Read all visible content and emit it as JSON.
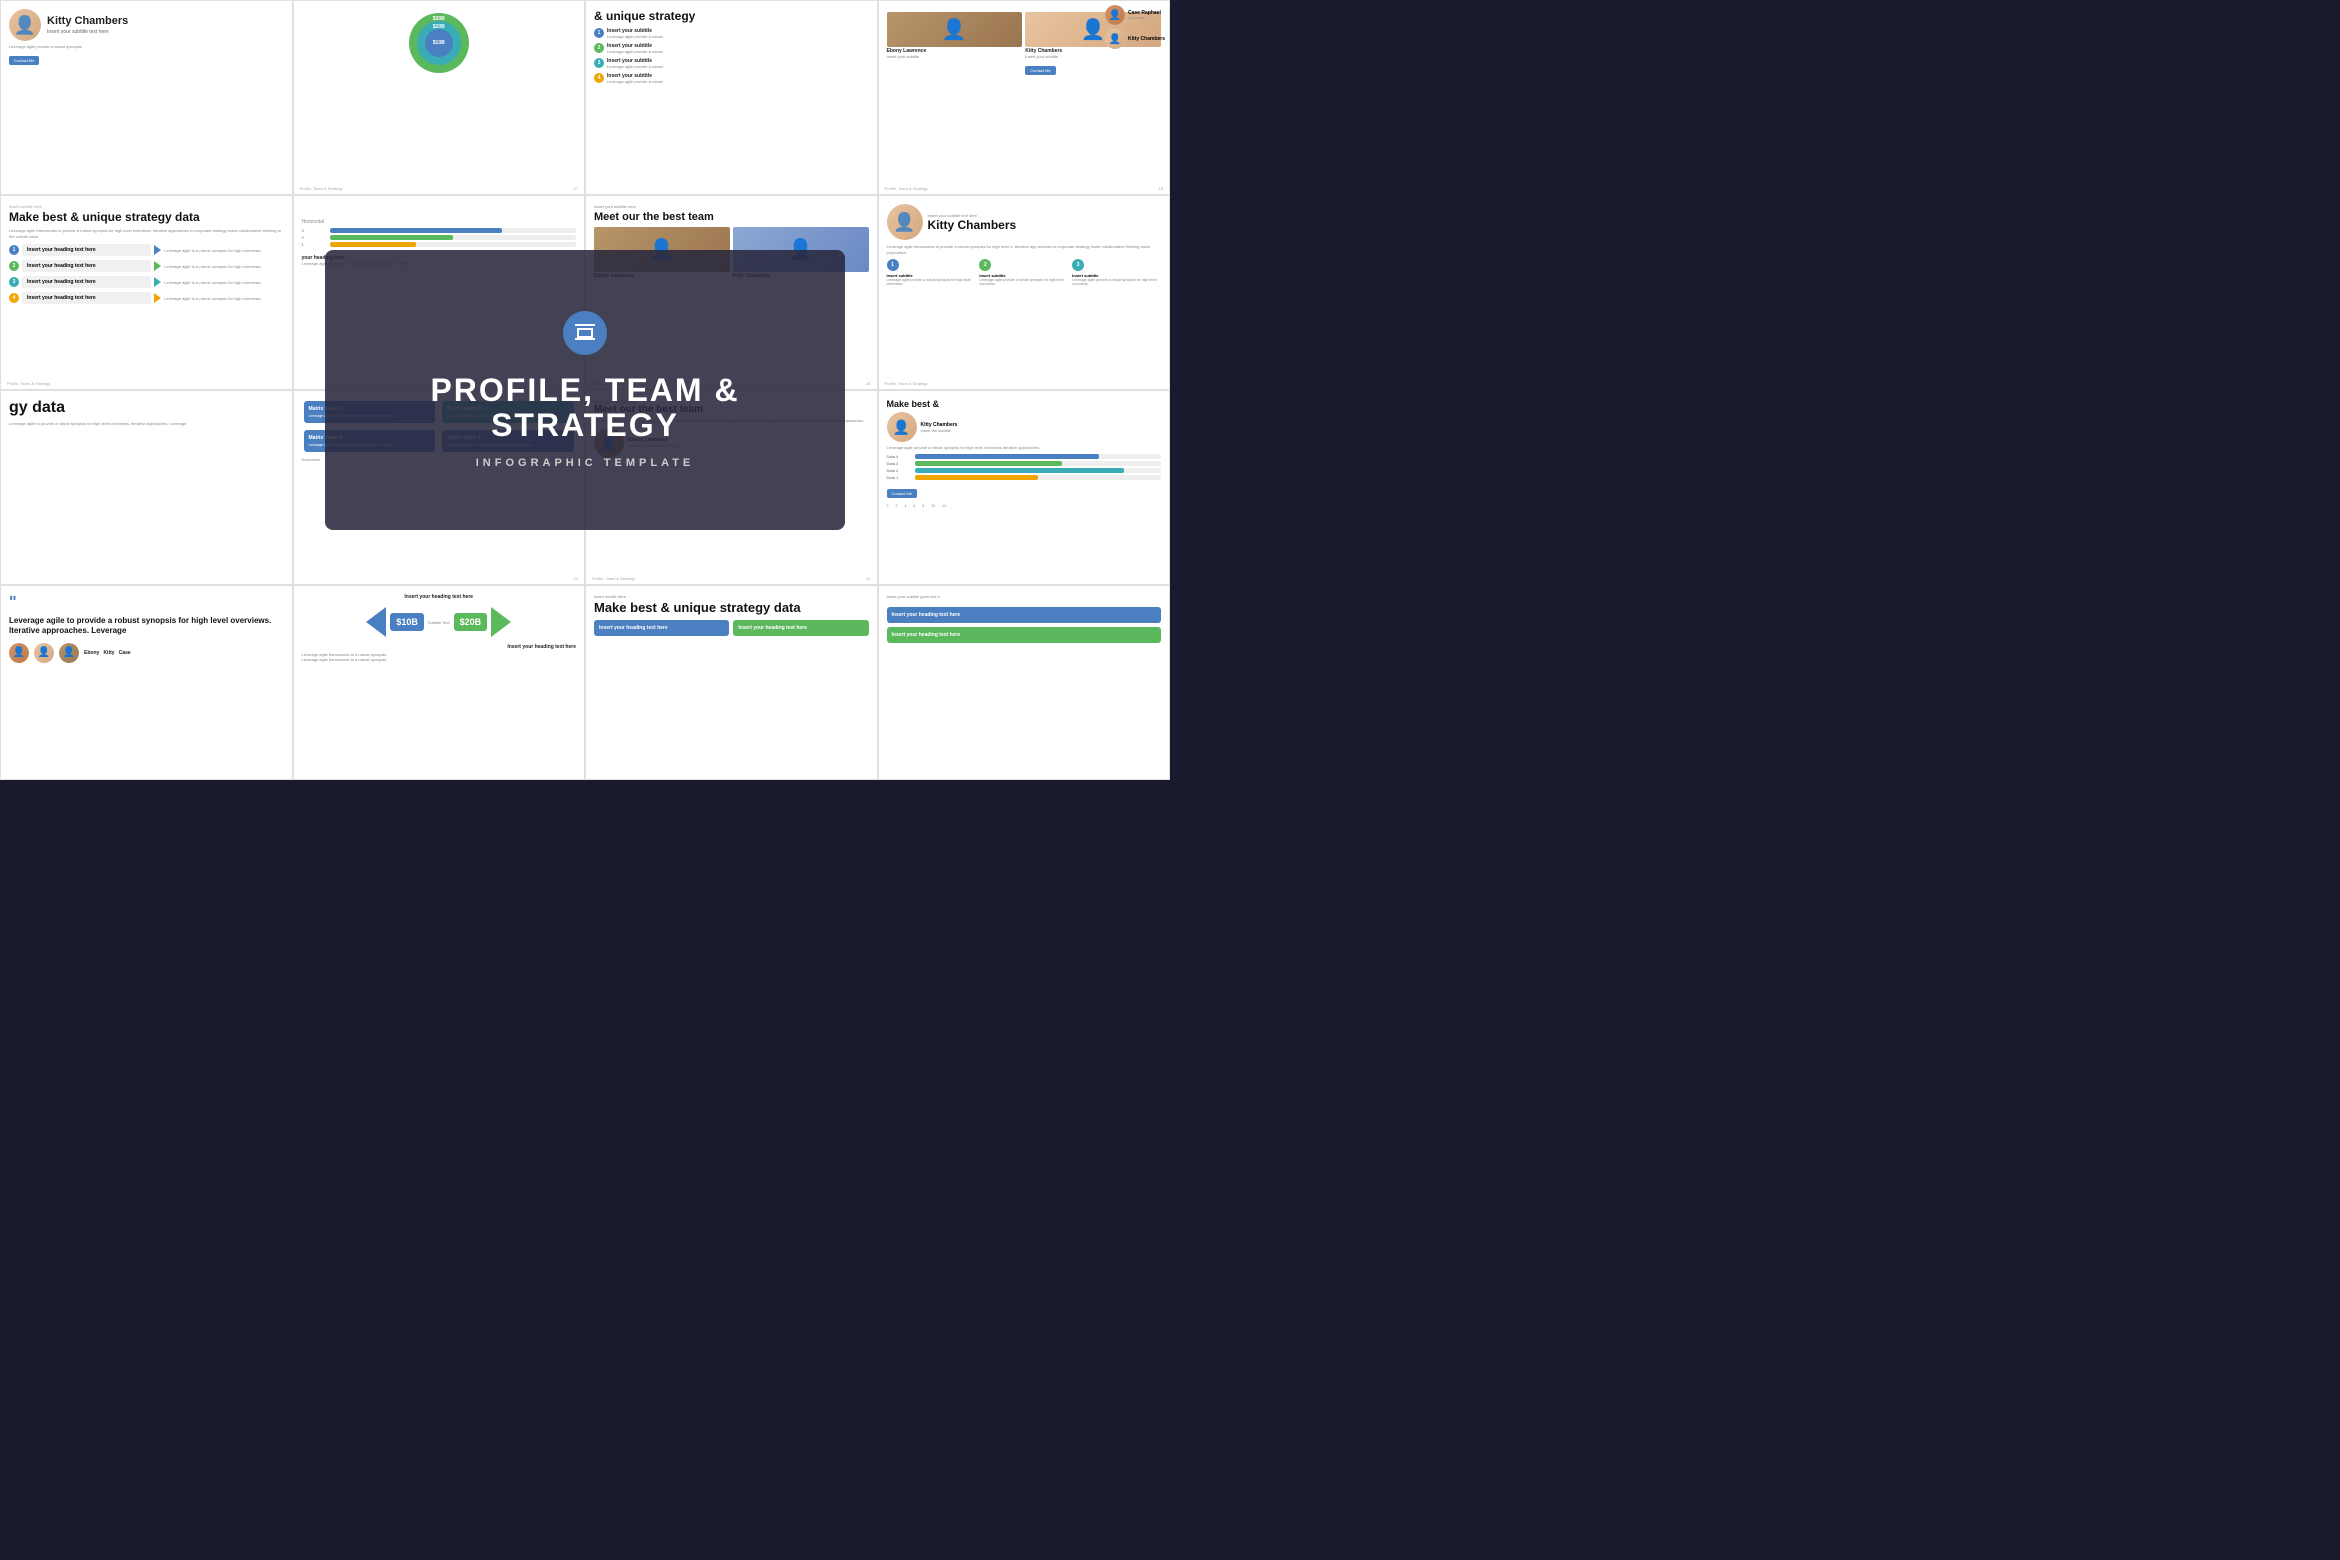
{
  "overlay": {
    "title": "PROFILE, TEAM &\nSTRATEGY",
    "subtitle": "INFOGRAPHIC TEMPLATE"
  },
  "slides": [
    {
      "id": "top-1",
      "type": "profile",
      "tag": "",
      "name": "Kitty Chambers",
      "subtitle_label": "Insert your subtitle text here",
      "body_text": "Leverage agile provide a robust synopsis",
      "btn": "Contact Me",
      "page": ""
    },
    {
      "id": "top-2",
      "type": "concentric",
      "values": [
        "$30B",
        "$20B",
        "$10B"
      ],
      "colors": [
        "#5cb85c",
        "#3aacb5",
        "#4a7fc1"
      ],
      "page": "27"
    },
    {
      "id": "top-3",
      "type": "strategy",
      "heading": "& unique strategy",
      "items": [
        {
          "label": "Insert your subtitle",
          "text": "Leverage agile provide a robust"
        },
        {
          "label": "Insert your subtitle",
          "text": "Leverage agile provide a robust"
        },
        {
          "label": "Insert your subtitle",
          "text": "Leverage agile provide a robust"
        },
        {
          "label": "Insert your subtitle",
          "text": "Leverage agile provide a robust"
        }
      ],
      "page": ""
    },
    {
      "id": "top-4",
      "type": "team-grid",
      "profiles": [
        {
          "name": "Ebony Lawrence",
          "subtitle": "Insert your subtitle"
        },
        {
          "name": "Kitty Chambers",
          "subtitle": "Insert your subtitle"
        }
      ],
      "extra_profiles": [
        {
          "name": "Case Raphael",
          "subtitle": "Insert your subtitle"
        },
        {
          "name": "Kitty Chambers",
          "subtitle": ""
        }
      ],
      "page": ""
    },
    {
      "id": "mid-1",
      "type": "strategy-list",
      "tag": "Insert subtitle here",
      "heading": "Make best & unique strategy data",
      "body": "Leverage agile frameworks to provide a robust synopsis for high level overviews. Iterative approaches to corporate strategy foster collaborative thinking to the overall value.",
      "items": [
        {
          "label": "Insert your heading text here"
        },
        {
          "label": "Insert your heading text here"
        },
        {
          "label": "Insert your heading text here"
        },
        {
          "label": "Insert your heading text here"
        }
      ],
      "page": "Profile, Team & Strategy"
    },
    {
      "id": "mid-2",
      "type": "blank",
      "page": "25"
    },
    {
      "id": "mid-3",
      "type": "team",
      "tag": "Insert your subtitle here",
      "heading": "Meet our the best team",
      "profiles": [
        {
          "name": "Ebony Lawrence"
        },
        {
          "name": "Kitty Chambers"
        }
      ],
      "page": "18"
    },
    {
      "id": "mid-4",
      "type": "profile-detail",
      "tag": "Insert your subtitle text here",
      "name": "Kitty Chambers",
      "body": "Leverage agile frameworks to provide a robust synopsis for high level e. iterative app reaches to corporate strategy foster collaborative thinking value proposition. Organically grow the holistic world.",
      "items": [
        {
          "num": "1",
          "label": "Insert subtitle",
          "text": "Leverage agile provide a robust synopsis for high level overviews."
        },
        {
          "num": "2",
          "label": "Insert subtitle",
          "text": "Leverage agile provide a robust synopsis for high level overviews."
        },
        {
          "num": "3",
          "label": "Insert subtitle",
          "text": "Leverage agile provide a robust synopsis for high level overviews."
        }
      ],
      "page": "Profile, Team & Strategy"
    },
    {
      "id": "bot-1",
      "type": "text-partial",
      "heading": "gy data",
      "body": "Leverage agile to provide a robust synopsis for high level overviews. Iterative approaches.",
      "page": ""
    },
    {
      "id": "bot-2",
      "type": "matrix",
      "cards": [
        {
          "label": "Matrix Value A",
          "text": "Leverage agile to a robust synopsis for high overviews.",
          "color": "blue"
        },
        {
          "label": "Matrix Value B",
          "text": "",
          "color": "teal"
        },
        {
          "label": "Matrix Value B",
          "text": "Leverage agile to a robust synopsis for high overviews.",
          "color": "blue"
        },
        {
          "label": "Matrix Value A",
          "text": "Leverage agile to a robust synopsis for high overviews.",
          "color": "blue"
        }
      ],
      "label_horizontal": "Horizontal",
      "page": "25"
    },
    {
      "id": "bot-3",
      "type": "team-small",
      "tag": "Insert your subtitle here",
      "heading": "Meet our the best team",
      "body": "Leverage agile provide a robust synopsis for high level overviews Leverage agile provide a robust synopsis for high level overviews iterative approaches.",
      "profile": {
        "name": "Ebony Lawrence",
        "subtitle": "Insert your subtitle text here"
      },
      "page": "Profile, Team & Strategy"
    },
    {
      "id": "bot-4",
      "type": "profile-bar",
      "heading": "Make best &",
      "profile": {
        "name": "Kitty Chambers",
        "subtitle": "Insert the subtitle"
      },
      "body": "Leverage agile provide a robust synopsis for high level overviews iterative approaches.",
      "btn": "Contact Me",
      "bars": [
        {
          "label": "Data 4",
          "pct": 75,
          "color": "#4a7fc1"
        },
        {
          "label": "Data 3",
          "pct": 60,
          "color": "#5cb85c"
        },
        {
          "label": "Data 2",
          "pct": 85,
          "color": "#3aacb5"
        },
        {
          "label": "Data 1",
          "pct": 50,
          "color": "#f0a500"
        }
      ],
      "page": ""
    },
    {
      "id": "last-1",
      "type": "quote",
      "text": "Leverage agile to provide a robust synopsis for high level overviews. Iterative approaches. Leverage",
      "profiles": [
        "Ebony",
        "Kitty",
        "Case"
      ],
      "page": ""
    },
    {
      "id": "last-2",
      "type": "arrows",
      "tag": "Insert your heading text here",
      "values": [
        {
          "amount": "$10B",
          "sub": "Subtitle Text",
          "color": "blue"
        },
        {
          "amount": "$20B",
          "sub": "Subtitle Text",
          "color": "green"
        }
      ],
      "right_tag": "Insert your heading text here",
      "page": ""
    },
    {
      "id": "last-3",
      "type": "strategy-large",
      "tag": "Insert subtile here",
      "heading": "Make best & unique strategy data",
      "items": [
        {
          "label": "Insert your heading text here"
        },
        {
          "label": "Insert your heading text here"
        }
      ],
      "page": ""
    },
    {
      "id": "last-4",
      "type": "strategy-boxes",
      "heading": "Insert your subtitle goes text h",
      "items": [
        {
          "label": "Insert your heading text here",
          "color": "blue"
        },
        {
          "label": "Insert your heading text here",
          "color": "green"
        }
      ],
      "page": ""
    }
  ]
}
